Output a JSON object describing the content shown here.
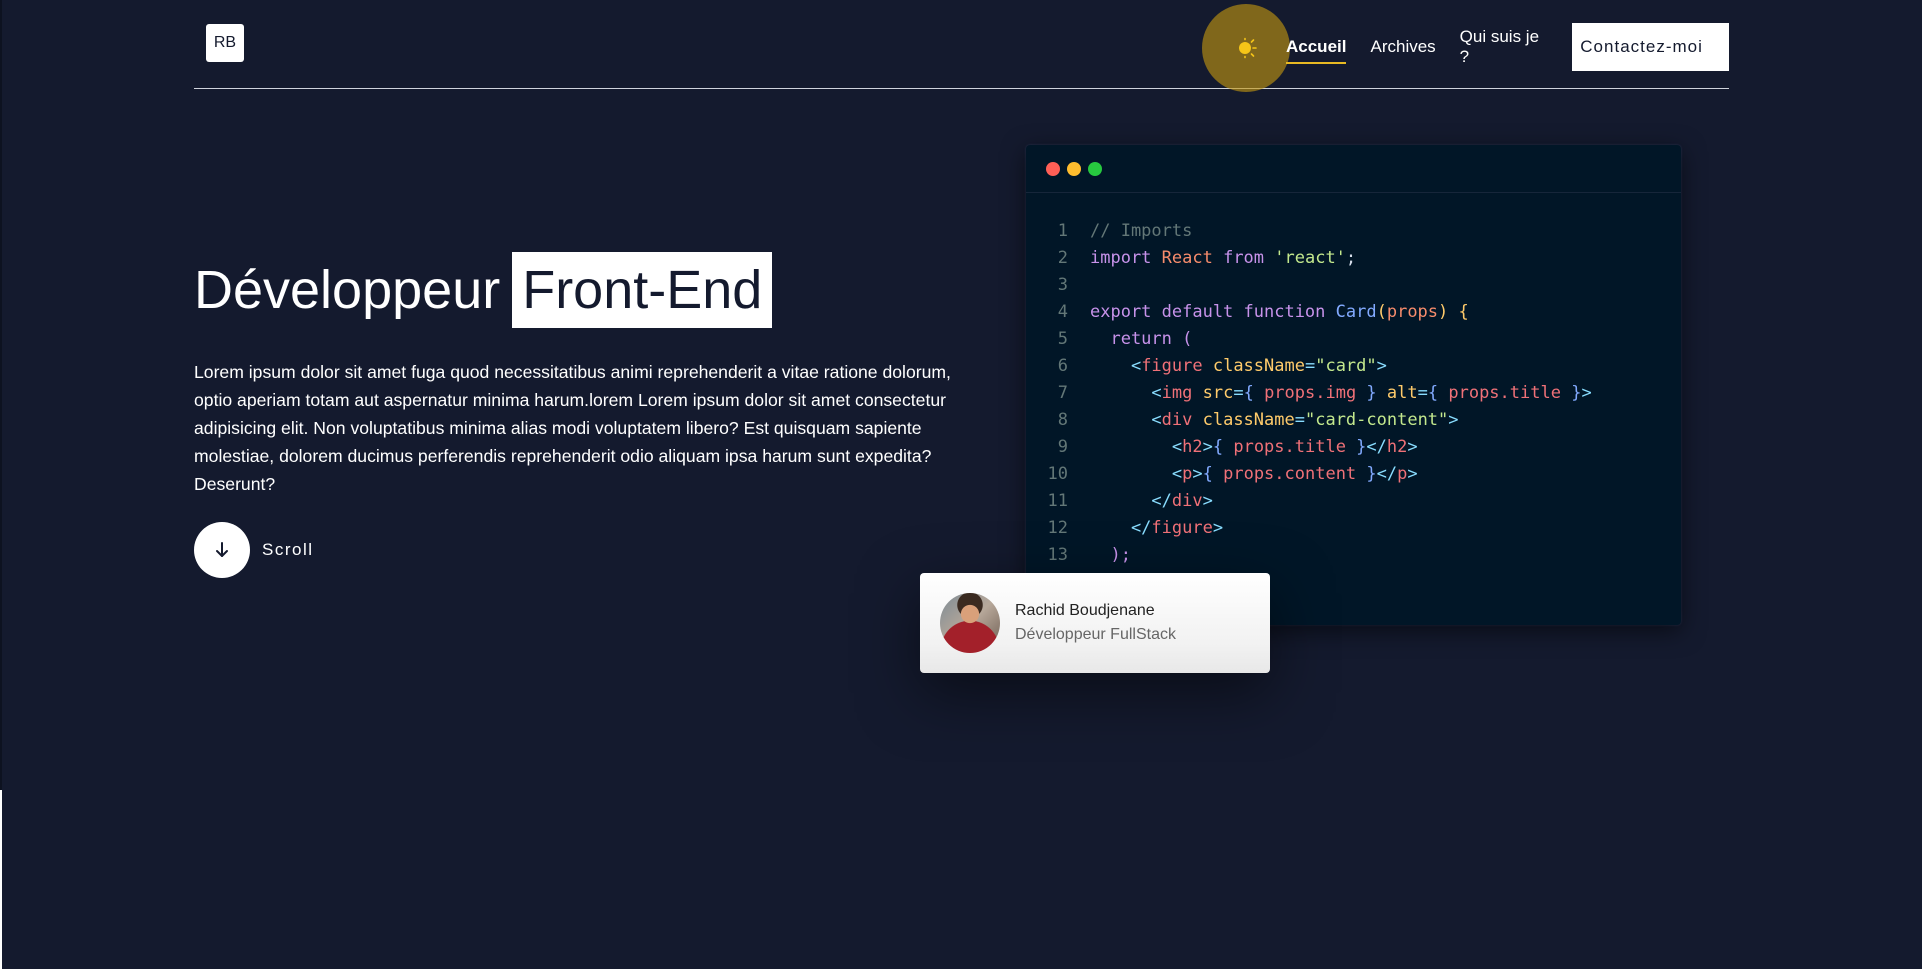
{
  "header": {
    "logo": "RB",
    "nav": [
      {
        "label": "Accueil",
        "active": true
      },
      {
        "label": "Archives",
        "active": false
      },
      {
        "label": "Qui suis je ?",
        "active": false
      }
    ],
    "contact_label": "Contactez-moi",
    "theme_icon": "sun-icon"
  },
  "hero": {
    "title_plain": "Développeur",
    "title_highlight": "Front-End",
    "text": "Lorem ipsum dolor sit amet fuga quod necessitatibus animi reprehenderit a vitae ratione dolorum, optio aperiam totam aut aspernatur minima harum.lorem Lorem ipsum dolor sit amet consectetur adipisicing elit. Non voluptatibus minima alias modi voluptatem libero? Est quisquam sapiente molestiae, dolorem ducimus perferendis reprehenderit odio aliquam ipsa harum sunt expedita? Deserunt?",
    "scroll_label": "Scroll",
    "scroll_icon": "arrow-down-icon"
  },
  "code_window": {
    "dots": [
      "#ff5f56",
      "#ffbd2e",
      "#27c93f"
    ],
    "lines": [
      {
        "n": "1",
        "tokens": [
          {
            "t": "// Imports",
            "c": "comment"
          }
        ]
      },
      {
        "n": "2",
        "tokens": [
          {
            "t": "import ",
            "c": "kw"
          },
          {
            "t": "React ",
            "c": "name"
          },
          {
            "t": "from ",
            "c": "kw"
          },
          {
            "t": "'react'",
            "c": "str"
          },
          {
            "t": ";",
            "c": "plain"
          }
        ]
      },
      {
        "n": "3",
        "tokens": []
      },
      {
        "n": "4",
        "tokens": [
          {
            "t": "export default function ",
            "c": "kw"
          },
          {
            "t": "Card",
            "c": "fn"
          },
          {
            "t": "(",
            "c": "paren"
          },
          {
            "t": "props",
            "c": "name"
          },
          {
            "t": ") {",
            "c": "paren"
          }
        ]
      },
      {
        "n": "5",
        "tokens": [
          {
            "t": "  return (",
            "c": "kw"
          }
        ]
      },
      {
        "n": "6",
        "tokens": [
          {
            "t": "    <",
            "c": "punct"
          },
          {
            "t": "figure ",
            "c": "tag"
          },
          {
            "t": "className",
            "c": "attr"
          },
          {
            "t": "=",
            "c": "punct"
          },
          {
            "t": "\"card\"",
            "c": "str"
          },
          {
            "t": ">",
            "c": "punct"
          }
        ]
      },
      {
        "n": "7",
        "tokens": [
          {
            "t": "      <",
            "c": "punct"
          },
          {
            "t": "img ",
            "c": "tag"
          },
          {
            "t": "src",
            "c": "attr"
          },
          {
            "t": "=",
            "c": "punct"
          },
          {
            "t": "{ ",
            "c": "brace"
          },
          {
            "t": "props.img ",
            "c": "tag"
          },
          {
            "t": "} ",
            "c": "brace"
          },
          {
            "t": "alt",
            "c": "attr"
          },
          {
            "t": "=",
            "c": "punct"
          },
          {
            "t": "{ ",
            "c": "brace"
          },
          {
            "t": "props.title ",
            "c": "tag"
          },
          {
            "t": "}",
            "c": "brace"
          },
          {
            "t": ">",
            "c": "punct"
          }
        ]
      },
      {
        "n": "8",
        "tokens": [
          {
            "t": "      <",
            "c": "punct"
          },
          {
            "t": "div ",
            "c": "tag"
          },
          {
            "t": "className",
            "c": "attr"
          },
          {
            "t": "=",
            "c": "punct"
          },
          {
            "t": "\"card-content\"",
            "c": "str"
          },
          {
            "t": ">",
            "c": "punct"
          }
        ]
      },
      {
        "n": "9",
        "tokens": [
          {
            "t": "        <",
            "c": "punct"
          },
          {
            "t": "h2",
            "c": "tag"
          },
          {
            "t": ">",
            "c": "punct"
          },
          {
            "t": "{ ",
            "c": "brace"
          },
          {
            "t": "props.title ",
            "c": "tag"
          },
          {
            "t": "}",
            "c": "brace"
          },
          {
            "t": "</",
            "c": "punct"
          },
          {
            "t": "h2",
            "c": "tag"
          },
          {
            "t": ">",
            "c": "punct"
          }
        ]
      },
      {
        "n": "10",
        "tokens": [
          {
            "t": "        <",
            "c": "punct"
          },
          {
            "t": "p",
            "c": "tag"
          },
          {
            "t": ">",
            "c": "punct"
          },
          {
            "t": "{ ",
            "c": "brace"
          },
          {
            "t": "props.content ",
            "c": "tag"
          },
          {
            "t": "}",
            "c": "brace"
          },
          {
            "t": "</",
            "c": "punct"
          },
          {
            "t": "p",
            "c": "tag"
          },
          {
            "t": ">",
            "c": "punct"
          }
        ]
      },
      {
        "n": "11",
        "tokens": [
          {
            "t": "      </",
            "c": "punct"
          },
          {
            "t": "div",
            "c": "tag"
          },
          {
            "t": ">",
            "c": "punct"
          }
        ]
      },
      {
        "n": "12",
        "tokens": [
          {
            "t": "    </",
            "c": "punct"
          },
          {
            "t": "figure",
            "c": "tag"
          },
          {
            "t": ">",
            "c": "punct"
          }
        ]
      },
      {
        "n": "13",
        "tokens": [
          {
            "t": "  );",
            "c": "kw"
          }
        ]
      }
    ]
  },
  "profile": {
    "name": "Rachid Boudjenane",
    "role": "Développeur FullStack"
  }
}
